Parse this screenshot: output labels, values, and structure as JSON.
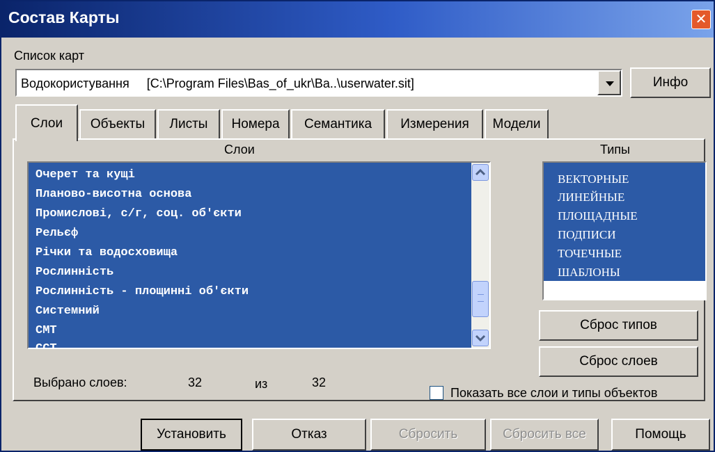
{
  "window": {
    "title": "Состав Карты",
    "close": "✕"
  },
  "maplist": {
    "label": "Список карт",
    "selected_name": "Водокористування",
    "selected_path": "[C:\\Program Files\\Bas_of_ukr\\Ba..\\userwater.sit]",
    "info_button": "Инфо"
  },
  "tabs": [
    "Слои",
    "Объекты",
    "Листы",
    "Номера",
    "Семантика",
    "Измерения",
    "Модели"
  ],
  "layers": {
    "header": "Слои",
    "items": [
      "Очерет та кущі",
      "Планово-висотна основа",
      "Промислові, с/г, соц. об'єкти",
      "Рельєф",
      "Річки та водосховища",
      "Рослинність",
      "Рослинність - площинні об'єкти",
      "Системний",
      "СМТ",
      "ССТ"
    ]
  },
  "types": {
    "header": "Типы",
    "items": [
      "ВЕКТОРНЫЕ",
      "ЛИНЕЙНЫЕ",
      "ПЛОЩАДНЫЕ",
      "ПОДПИСИ",
      "ТОЧЕЧНЫЕ",
      "ШАБЛОНЫ"
    ]
  },
  "buttons": {
    "reset_types": "Сброс типов",
    "reset_layers": "Сброс слоев",
    "set": "Установить",
    "cancel": "Отказ",
    "reset": "Сбросить",
    "reset_all": "Сбросить все",
    "help": "Помощь"
  },
  "selection": {
    "label": "Выбрано слоев:",
    "selected": "32",
    "of_label": "из",
    "total": "32"
  },
  "show_all": {
    "label": "Показать все слои и типы объектов",
    "checked": false
  }
}
